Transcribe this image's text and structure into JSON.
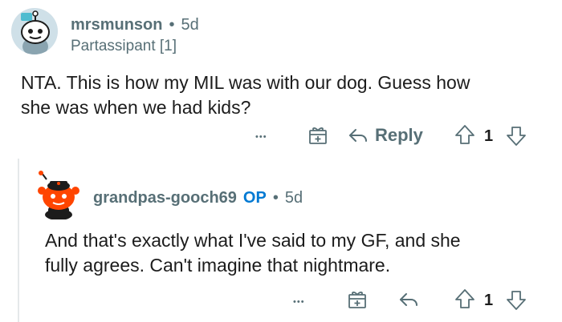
{
  "comments": [
    {
      "username": "mrsmunson",
      "separator": "•",
      "age": "5d",
      "flair": "Partassipant [1]",
      "body": [
        "NTA. This is how my MIL was with our dog. Guess how",
        "she was when we had kids?"
      ],
      "actions": {
        "more": "•••",
        "reply_label": "Reply",
        "vote_count": "1"
      },
      "icons": [
        "more-icon",
        "award-icon",
        "reply-icon",
        "upvote-icon",
        "downvote-icon"
      ]
    },
    {
      "username": "grandpas-gooch69",
      "op_badge": "OP",
      "separator": "•",
      "age": "5d",
      "body": [
        "And that's exactly what I've said to my GF, and she",
        "fully agrees. Can't imagine that nightmare."
      ],
      "actions": {
        "more": "•••",
        "vote_count": "1"
      },
      "icons": [
        "more-icon",
        "award-icon",
        "reply-icon",
        "upvote-icon",
        "downvote-icon"
      ]
    }
  ],
  "colors": {
    "meta_gray": "#576f76",
    "text": "#1c1c1c",
    "op_blue": "#0079d3",
    "avatar_red": "#ff4500",
    "thread_line": "#e5e8ea"
  }
}
